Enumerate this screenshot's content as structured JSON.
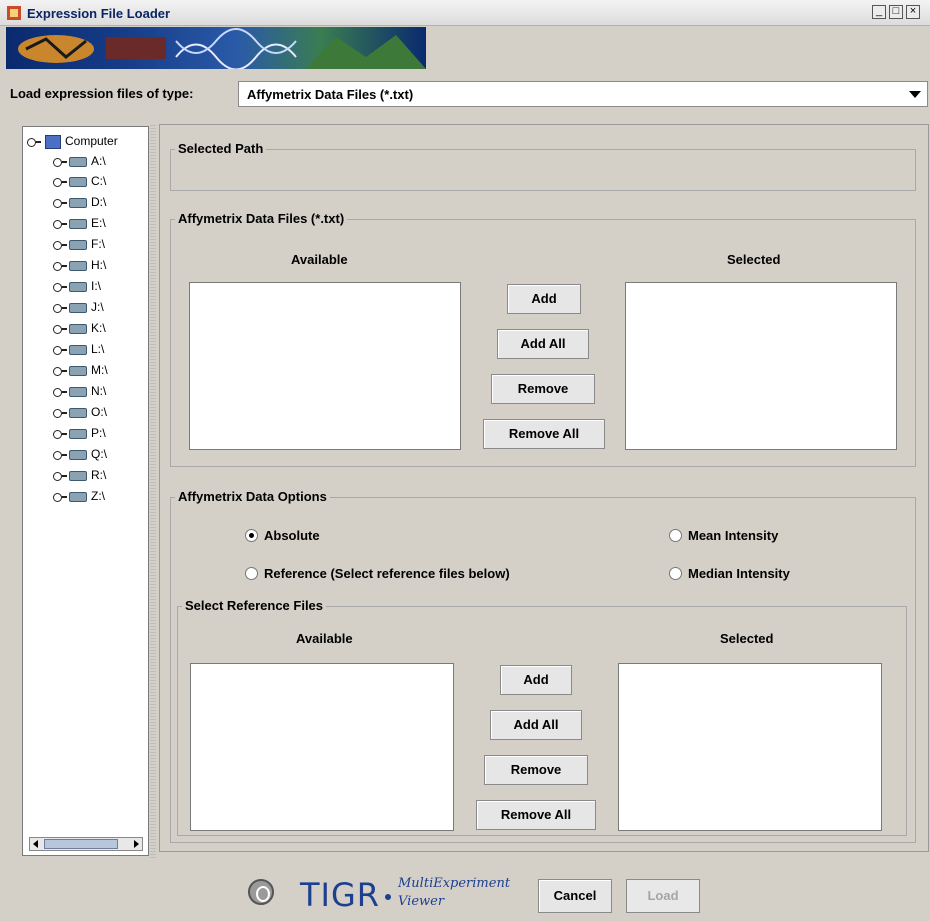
{
  "window": {
    "title": "Expression File Loader"
  },
  "load_type": {
    "label": "Load expression files of type:",
    "selected": "Affymetrix Data Files (*.txt)"
  },
  "tree": {
    "root": "Computer",
    "drives": [
      "A:\\",
      "C:\\",
      "D:\\",
      "E:\\",
      "F:\\",
      "H:\\",
      "I:\\",
      "J:\\",
      "K:\\",
      "L:\\",
      "M:\\",
      "N:\\",
      "O:\\",
      "P:\\",
      "Q:\\",
      "R:\\",
      "Z:\\"
    ]
  },
  "selected_path": {
    "title": "Selected Path"
  },
  "data_files": {
    "title": "Affymetrix Data Files (*.txt)",
    "available_label": "Available",
    "selected_label": "Selected",
    "buttons": {
      "add": "Add",
      "add_all": "Add All",
      "remove": "Remove",
      "remove_all": "Remove All"
    }
  },
  "options": {
    "title": "Affymetrix Data Options",
    "absolute": "Absolute",
    "reference": "Reference (Select reference files below)",
    "mean_intensity": "Mean Intensity",
    "median_intensity": "Median Intensity",
    "selected_option": "absolute"
  },
  "reference_files": {
    "title": "Select Reference Files",
    "available_label": "Available",
    "selected_label": "Selected",
    "buttons": {
      "add": "Add",
      "add_all": "Add All",
      "remove": "Remove",
      "remove_all": "Remove All"
    }
  },
  "footer": {
    "brand": "TIGR",
    "product_line1": "MultiExperiment",
    "product_line2": "Viewer",
    "cancel": "Cancel",
    "load": "Load"
  }
}
